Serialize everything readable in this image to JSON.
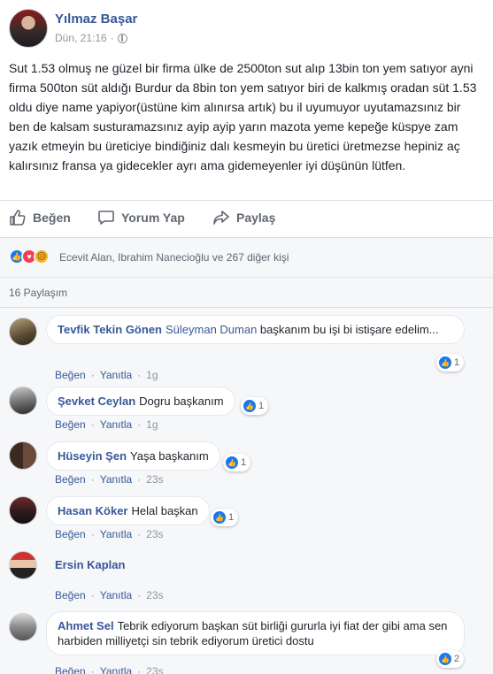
{
  "post": {
    "author": "Yılmaz Başar",
    "time": "Dün, 21:16",
    "dot": "·",
    "text": "Sut 1.53 olmuş ne güzel bir firma ülke de 2500ton sut alıp 13bin ton yem satıyor ayni firma 500ton süt aldığı Burdur da 8bin ton yem satıyor biri de kalkmış oradan süt 1.53 oldu diye name yapiyor(üstüne kim alınırsa artık) bu il uyumuyor uyutamazsınız bir ben de kalsam susturamazsınız ayip ayip yarın mazota yeme kepeğe küspye zam yazık etmeyin bu üreticiye bindiğiniz dalı kesmeyin bu üretici üretmezse hepiniz aç kalırsınız fransa ya gidecekler ayrı ama gidemeyenler iyi düşünün lütfen."
  },
  "actions": {
    "like": "Beğen",
    "comment": "Yorum Yap",
    "share": "Paylaş"
  },
  "reactions": {
    "icons": [
      "like-icon",
      "love-icon",
      "sad-icon"
    ],
    "summary": "Ecevit Alan, Ibrahim Nanecioğlu ve 267 diğer kişi"
  },
  "shares": "16 Paylaşım",
  "comment_actions": {
    "like": "Beğen",
    "reply": "Yanıtla",
    "dot": "·"
  },
  "comments": [
    {
      "name": "Tevfik Tekin Gönen",
      "mention": "Süleyman Duman",
      "text": " başkanım bu işi bi istişare edelim...",
      "time": "1g",
      "likes": "1"
    },
    {
      "name": "Şevket Ceylan",
      "mention": "",
      "text": "Dogru başkanım",
      "time": "1g",
      "likes": "1"
    },
    {
      "name": "Hüseyin Şen",
      "mention": "",
      "text": "Yaşa başkanım",
      "time": "23s",
      "likes": "1"
    },
    {
      "name": "Hasan Köker",
      "mention": "",
      "text": "Helal başkan",
      "time": "23s",
      "likes": "1"
    },
    {
      "name": "Ersin Kaplan",
      "mention": "",
      "text": "",
      "time": "23s",
      "likes": ""
    },
    {
      "name": "Ahmet Sel",
      "mention": "",
      "text": "Tebrik ediyorum başkan süt birliği gururla iyi fiat der gibi ama sen harbiden milliyetçi sin tebrik ediyorum üretici dostu",
      "time": "23s",
      "likes": "2"
    }
  ],
  "colors": {
    "link": "#365899",
    "like_blue": "#1877f2",
    "love_red": "#f33e58",
    "sad_yellow": "#f7b125"
  }
}
